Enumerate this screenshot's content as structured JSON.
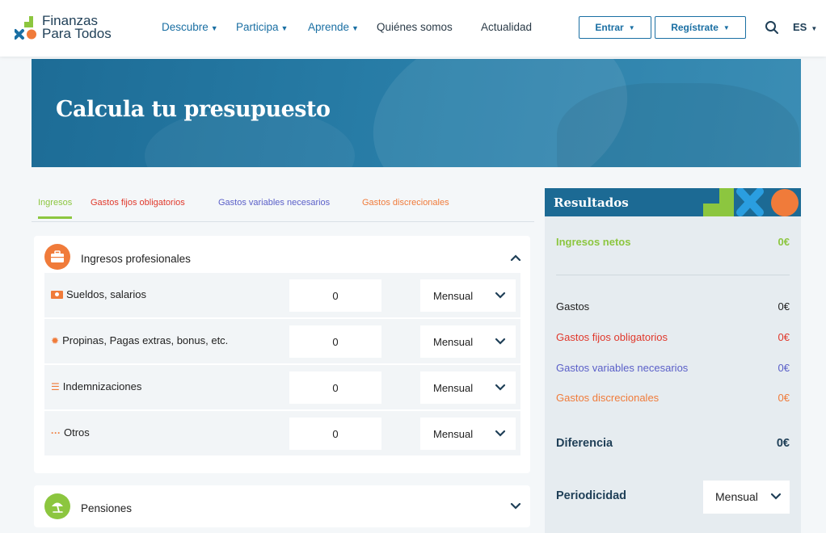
{
  "header": {
    "logo_line1": "Finanzas",
    "logo_line2": "Para Todos",
    "nav": [
      {
        "label": "Descubre",
        "caret": "▼"
      },
      {
        "label": "Participa",
        "caret": "▼"
      },
      {
        "label": "Aprende",
        "caret": "▼"
      },
      {
        "label": "Quiénes somos"
      },
      {
        "label": "Actualidad"
      }
    ],
    "login_label": "Entrar",
    "register_label": "Regístrate",
    "lang_label": "ES",
    "brand_color": "#1a6fa3"
  },
  "hero": {
    "title": "Calcula tu presupuesto"
  },
  "tabs": [
    {
      "label": "Ingresos",
      "color": "#8cc63f",
      "active": true
    },
    {
      "label": "Gastos fijos obligatorios",
      "color": "#e0382b"
    },
    {
      "label": "Gastos variables necesarios",
      "color": "#5a5fc8"
    },
    {
      "label": "Gastos discrecionales",
      "color": "#f07b3a"
    }
  ],
  "sections": [
    {
      "title": "Ingresos profesionales",
      "icon": "briefcase-icon",
      "icon_color": "#f07b3a",
      "expanded": true,
      "rows": [
        {
          "label": "Sueldos, salarios",
          "icon": "cash-icon",
          "value": "0",
          "period": "Mensual"
        },
        {
          "label": "Propinas, Pagas extras, bonus, etc.",
          "icon": "badge-icon",
          "value": "0",
          "period": "Mensual"
        },
        {
          "label": "Indemnizaciones",
          "icon": "coins-icon",
          "value": "0",
          "period": "Mensual"
        },
        {
          "label": "Otros",
          "icon": "dots-icon",
          "value": "0",
          "period": "Mensual"
        }
      ]
    },
    {
      "title": "Pensiones",
      "icon": "umbrella-icon",
      "icon_color": "#8cc63f",
      "expanded": false
    }
  ],
  "results": {
    "title": "Resultados",
    "ingresos_label": "Ingresos netos",
    "ingresos_value": "0€",
    "gastos_label": "Gastos",
    "gastos_value": "0€",
    "fijos_label": "Gastos fijos obligatorios",
    "fijos_value": "0€",
    "variables_label": "Gastos variables necesarios",
    "variables_value": "0€",
    "discrecionales_label": "Gastos discrecionales",
    "discrecionales_value": "0€",
    "diferencia_label": "Diferencia",
    "diferencia_value": "0€",
    "periodicidad_label": "Periodicidad",
    "periodicidad_value": "Mensual"
  }
}
